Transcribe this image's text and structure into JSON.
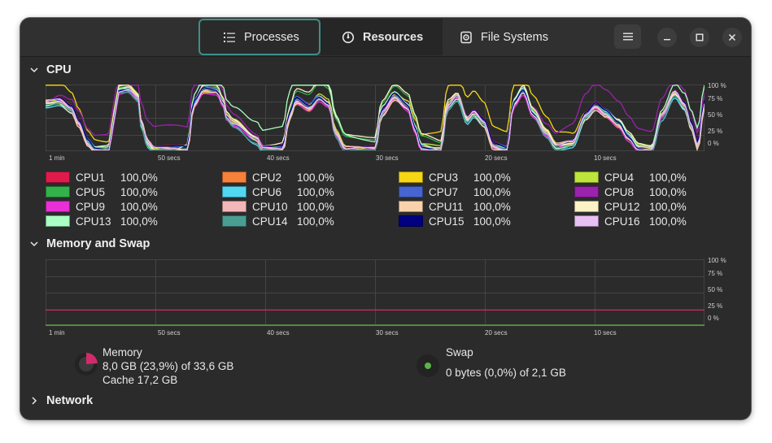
{
  "tabs": [
    {
      "label": "Processes"
    },
    {
      "label": "Resources"
    },
    {
      "label": "File Systems"
    }
  ],
  "sections": {
    "cpu": "CPU",
    "memory": "Memory and Swap",
    "network": "Network"
  },
  "x_ticks": [
    "1 min",
    "50 secs",
    "40 secs",
    "30 secs",
    "20 secs",
    "10 secs"
  ],
  "y_ticks": [
    "100 %",
    "75 %",
    "50 %",
    "25 %",
    "0 %"
  ],
  "cpu_legend": [
    {
      "name": "CPU1",
      "value": "100,0%",
      "color": "#e01b4c"
    },
    {
      "name": "CPU2",
      "value": "100,0%",
      "color": "#f6813a"
    },
    {
      "name": "CPU3",
      "value": "100,0%",
      "color": "#f7d613"
    },
    {
      "name": "CPU4",
      "value": "100,0%",
      "color": "#bde53b"
    },
    {
      "name": "CPU5",
      "value": "100,0%",
      "color": "#33b14a"
    },
    {
      "name": "CPU6",
      "value": "100,0%",
      "color": "#52d7f2"
    },
    {
      "name": "CPU7",
      "value": "100,0%",
      "color": "#4665d1"
    },
    {
      "name": "CPU8",
      "value": "100,0%",
      "color": "#9a22ac"
    },
    {
      "name": "CPU9",
      "value": "100,0%",
      "color": "#ea2fd6"
    },
    {
      "name": "CPU10",
      "value": "100,0%",
      "color": "#f4b7b9"
    },
    {
      "name": "CPU11",
      "value": "100,0%",
      "color": "#f9d2ac"
    },
    {
      "name": "CPU12",
      "value": "100,0%",
      "color": "#fdf2c4"
    },
    {
      "name": "CPU13",
      "value": "100,0%",
      "color": "#aaffc3"
    },
    {
      "name": "CPU14",
      "value": "100,0%",
      "color": "#4a9e91"
    },
    {
      "name": "CPU15",
      "value": "100,0%",
      "color": "#000080"
    },
    {
      "name": "CPU16",
      "value": "100,0%",
      "color": "#e8c0f4"
    }
  ],
  "memory": {
    "label": "Memory",
    "usage": "8,0 GB (23,9%) of 33,6 GB",
    "cache": "Cache 17,2 GB",
    "percent": 23.9,
    "color": "#d12b6b"
  },
  "swap": {
    "label": "Swap",
    "usage": "0 bytes (0,0%) of 2,1 GB",
    "percent": 0.0,
    "color": "#5ab548"
  }
}
